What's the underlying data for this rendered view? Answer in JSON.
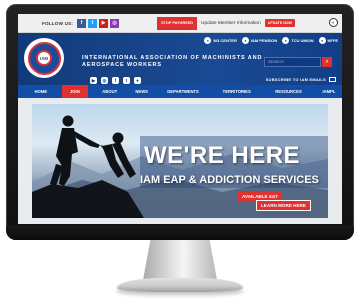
{
  "topbar": {
    "follow_label": "FOLLOW US:",
    "social_icons": [
      "facebook-icon",
      "twitter-icon",
      "youtube-icon",
      "instagram-icon"
    ],
    "tag": "STOP PAYGREED",
    "update_text": "Update Member Information",
    "update_button": "UPDATE NOW"
  },
  "header": {
    "org_name": "INTERNATIONAL ASSOCIATION OF MACHINISTS AND AEROSPACE WORKERS",
    "links": [
      {
        "label": "W3 CENTER"
      },
      {
        "label": "IAM PENSION"
      },
      {
        "label": "TCU UNION"
      },
      {
        "label": "NFFE"
      }
    ],
    "search_placeholder": "SEARCH",
    "subscribe": "SUBSCRIBE TO IAM EMAILS",
    "colors": {
      "header_blue": "#123a7a",
      "accent_red": "#e03131",
      "nav_blue": "#124da6"
    }
  },
  "nav": {
    "items": [
      {
        "label": "HOME"
      },
      {
        "label": "JOIN"
      },
      {
        "label": "ABOUT"
      },
      {
        "label": "NEWS"
      },
      {
        "label": "DEPARTMENTS"
      },
      {
        "label": "TERRITORIES"
      },
      {
        "label": "RESOURCES"
      },
      {
        "label": "IAMPL"
      }
    ],
    "active": "JOIN"
  },
  "banner": {
    "title": "WE'RE HERE",
    "subtitle": "IAM EAP & ADDICTION SERVICES",
    "available": "AVAILABLE 24/7",
    "learn_more": "LEARN MORE HERE"
  }
}
